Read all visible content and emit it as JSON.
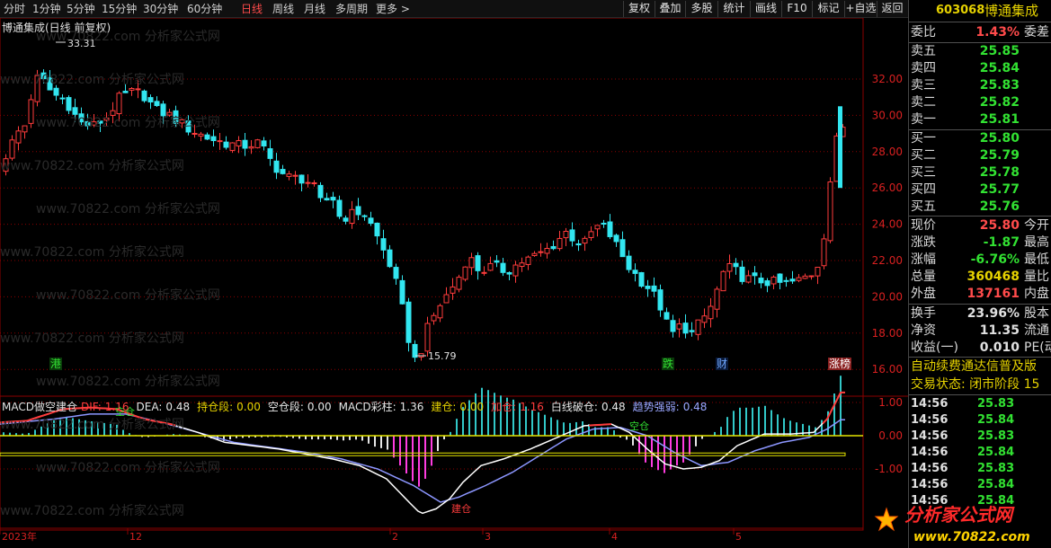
{
  "periods": [
    {
      "label": "分时",
      "active": false
    },
    {
      "label": "1分钟",
      "active": false
    },
    {
      "label": "5分钟",
      "active": false
    },
    {
      "label": "15分钟",
      "active": false
    },
    {
      "label": "30分钟",
      "active": false
    },
    {
      "label": "60分钟",
      "active": false
    },
    {
      "label": "日线",
      "active": true
    },
    {
      "label": "周线",
      "active": false
    },
    {
      "label": "月线",
      "active": false
    },
    {
      "label": "多周期",
      "active": false
    },
    {
      "label": "更多 >",
      "active": false
    }
  ],
  "right_buttons": [
    "复权",
    "叠加",
    "多股",
    "统计",
    "画线",
    "F10",
    "标记",
    "+自选",
    "返回"
  ],
  "stock": {
    "code": "603068",
    "name": "博通集成"
  },
  "chart_title": "博通集成(日线 前复权)",
  "watermark": "www.70822.com 分析家公式网",
  "price_axis": {
    "ticks": [
      "32.00",
      "30.00",
      "28.00",
      "26.00",
      "24.00",
      "22.00",
      "20.00",
      "18.00",
      "16.00"
    ],
    "high_label": "33.31",
    "low_label": "15.79"
  },
  "macd_axis": {
    "ticks": [
      "1.00",
      "0.00",
      "-1.00"
    ]
  },
  "date_axis": [
    {
      "label": "2023年"
    },
    {
      "label": "12"
    },
    {
      "label": "2"
    },
    {
      "label": "3"
    },
    {
      "label": "4"
    },
    {
      "label": "5"
    }
  ],
  "events": [
    {
      "label": "港",
      "color": "#32e132",
      "bg": "#0a3a0a"
    },
    {
      "label": "跌",
      "color": "#32e132",
      "bg": "#0a3a0a"
    },
    {
      "label": "财",
      "color": "#6fa8ff",
      "bg": "#0a1a3a"
    },
    {
      "label": "涨榜",
      "color": "#ffffff",
      "bg": "#8a2020"
    }
  ],
  "macd_indicator": {
    "name": "MACD做空建仓",
    "items": [
      {
        "label": "DIF:",
        "value": "1.16",
        "color": "#ff3c3c"
      },
      {
        "label": "DEA:",
        "value": "0.48",
        "color": "#e6e6e6"
      },
      {
        "label": "持仓段:",
        "value": "0.00",
        "color": "#e6d200"
      },
      {
        "label": "空仓段:",
        "value": "0.00",
        "color": "#e6e6e6"
      },
      {
        "label": "MACD彩柱:",
        "value": "1.36",
        "color": "#e6e6e6"
      },
      {
        "label": "建仓:",
        "value": "0.00",
        "color": "#e6d200"
      },
      {
        "label": "加仓:",
        "value": "1.16",
        "color": "#ff3c3c"
      },
      {
        "label": "白线破仓:",
        "value": "0.48",
        "color": "#e6e6e6"
      },
      {
        "label": "趋势强弱:",
        "value": "0.48",
        "color": "#9aa6ff"
      }
    ],
    "annotations": [
      "空仓",
      "建仓",
      "空仓"
    ]
  },
  "quote": {
    "ratio": {
      "label": "委比",
      "value": "1.43%",
      "label2": "委差"
    },
    "sells": [
      {
        "label": "卖五",
        "price": "25.85"
      },
      {
        "label": "卖四",
        "price": "25.84"
      },
      {
        "label": "卖三",
        "price": "25.83"
      },
      {
        "label": "卖二",
        "price": "25.82"
      },
      {
        "label": "卖一",
        "price": "25.81"
      }
    ],
    "buys": [
      {
        "label": "买一",
        "price": "25.80"
      },
      {
        "label": "买二",
        "price": "25.79"
      },
      {
        "label": "买三",
        "price": "25.78"
      },
      {
        "label": "买四",
        "price": "25.77"
      },
      {
        "label": "买五",
        "price": "25.76"
      }
    ],
    "stats1": [
      {
        "label": "现价",
        "value": "25.80",
        "label2": "今开",
        "color": "#ff4b4b"
      },
      {
        "label": "涨跌",
        "value": "-1.87",
        "label2": "最高",
        "color": "#32e132"
      },
      {
        "label": "涨幅",
        "value": "-6.76%",
        "label2": "最低",
        "color": "#32e132"
      },
      {
        "label": "总量",
        "value": "360468",
        "label2": "量比",
        "color": "#e6d200"
      },
      {
        "label": "外盘",
        "value": "137161",
        "label2": "内盘",
        "color": "#ff4b4b"
      }
    ],
    "stats2": [
      {
        "label": "换手",
        "value": "23.96%",
        "label2": "股本",
        "color": "#e0e0e0"
      },
      {
        "label": "净资",
        "value": "11.35",
        "label2": "流通",
        "color": "#e0e0e0"
      },
      {
        "label": "收益(一)",
        "value": "0.010",
        "label2": "PE(动",
        "color": "#e0e0e0"
      }
    ],
    "info_lines": [
      "自动续费通达信普及版",
      "交易状态: 闭市阶段 15"
    ],
    "ticks": [
      {
        "time": "14:56",
        "price": "25.83"
      },
      {
        "time": "14:56",
        "price": "25.84"
      },
      {
        "time": "14:56",
        "price": "25.83"
      },
      {
        "time": "14:56",
        "price": "25.84"
      },
      {
        "time": "14:56",
        "price": "25.83"
      },
      {
        "time": "14:56",
        "price": "25.84"
      },
      {
        "time": "14:56",
        "price": "25.84"
      }
    ]
  },
  "logo": {
    "text": "分析家公式网",
    "url": "www.70822.com"
  },
  "colors": {
    "up": "#ff3c3c",
    "down": "#32e6f0",
    "grid": "#8b0000",
    "dif": "#ff3c3c",
    "dea": "#ffffff",
    "trend": "#8c96ff",
    "hold": "#e6e600",
    "zero": "#e6e600"
  }
}
